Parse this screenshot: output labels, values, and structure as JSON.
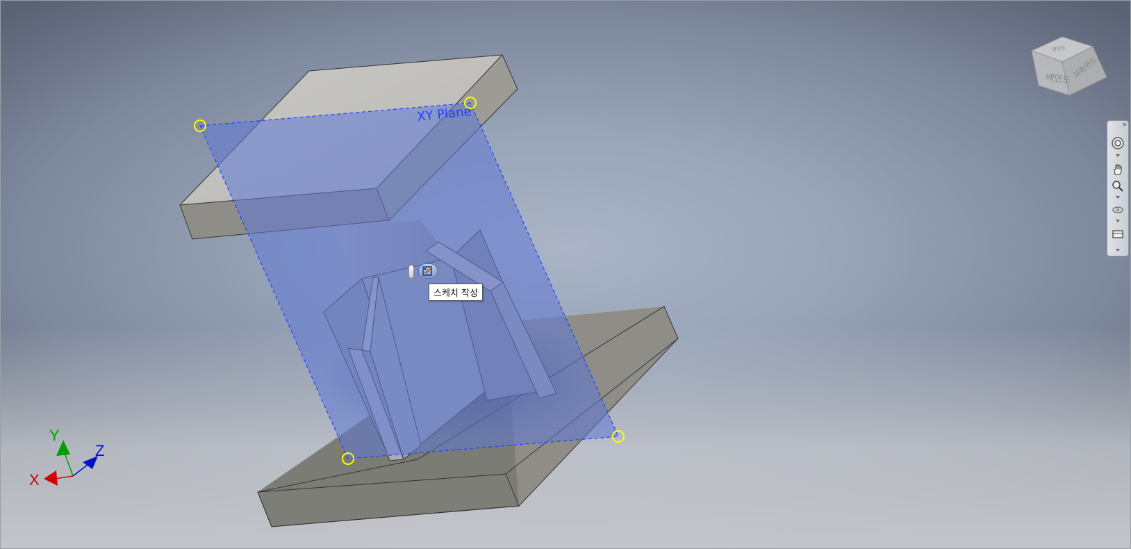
{
  "viewport": {
    "plane_label": "XY Plane",
    "tooltip_text": "스케치 작성",
    "colors": {
      "plane_fill": "#5f79d6",
      "plane_border": "#1f3fff",
      "solid_face_light": "#c3c2bf",
      "solid_face_dark": "#7d7d77",
      "handle_color": "#ffff00"
    }
  },
  "triad": {
    "x_label": "X",
    "y_label": "Y",
    "z_label": "Z",
    "x_color": "#d40000",
    "y_color": "#00a000",
    "z_color": "#0010c8"
  },
  "view_cube": {
    "front_label": "배면도",
    "side_label": "좌측면도",
    "top_label": "평면도"
  },
  "nav_bar": {
    "tools": [
      "steering-wheel-icon",
      "pan-icon",
      "zoom-icon",
      "orbit-icon",
      "look-at-icon"
    ]
  }
}
